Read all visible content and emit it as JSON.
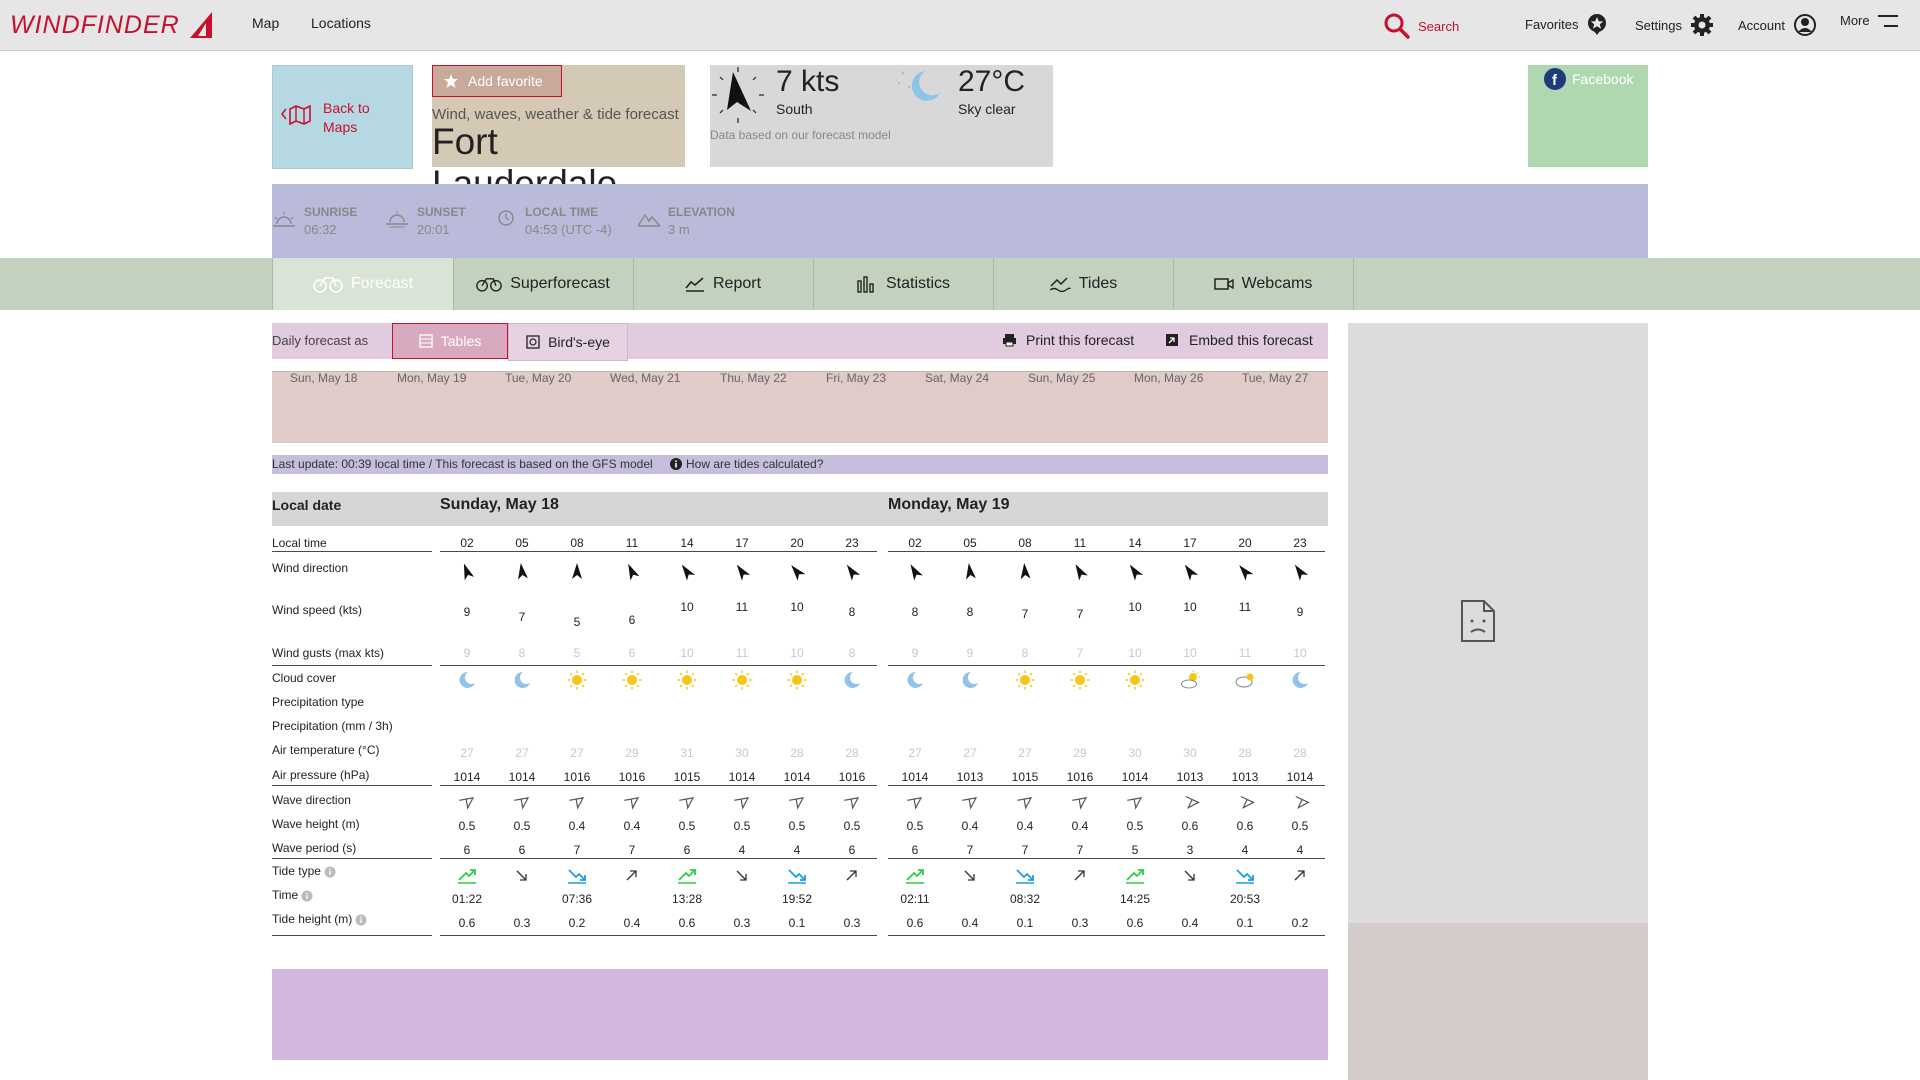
{
  "navbar": {
    "logo": "WINDFINDER",
    "links": [
      "Map",
      "Locations"
    ],
    "search_label": "Search",
    "favorites_label": "Favorites",
    "settings_label": "Settings",
    "account_label": "Account",
    "more_label": "More"
  },
  "back": {
    "label_line1": "Back to",
    "label_line2": "Maps"
  },
  "spot": {
    "add_favorite": "Add favorite",
    "subtitle": "Wind, waves, weather & tide forecast",
    "name": "Fort Lauderdale"
  },
  "current": {
    "wind_value": "7",
    "wind_unit": "kts",
    "wind_dir": "South",
    "temp_value": "27",
    "temp_unit": "°C",
    "sky": "Sky clear",
    "note": "Data based on our forecast model"
  },
  "social": {
    "facebook": "Facebook"
  },
  "info": [
    {
      "label": "SUNRISE",
      "value": "06:32"
    },
    {
      "label": "SUNSET",
      "value": "20:01"
    },
    {
      "label": "LOCAL TIME",
      "value": "04:53 (UTC -4)"
    },
    {
      "label": "ELEVATION",
      "value": "3 m"
    }
  ],
  "tabs": [
    "Forecast",
    "Superforecast",
    "Report",
    "Statistics",
    "Tides",
    "Webcams"
  ],
  "toolbar": {
    "daily_label": "Daily forecast as",
    "tables": "Tables",
    "birdseye": "Bird's-eye",
    "print": "Print this forecast",
    "embed": "Embed this forecast"
  },
  "days": [
    "Sun, May 18",
    "Mon, May 19",
    "Tue, May 20",
    "Wed, May 21",
    "Thu, May 22",
    "Fri, May 23",
    "Sat, May 24",
    "Sun, May 25",
    "Mon, May 26",
    "Tue, May 27"
  ],
  "update": {
    "text": "Last update: 00:39 local time / This forecast is based on the GFS model",
    "tides_link": "How are tides calculated?"
  },
  "table": {
    "local_date": "Local date",
    "day1": "Sunday, May 18",
    "day2": "Monday, May 19",
    "row_labels": [
      "Local time",
      "Wind direction",
      "Wind speed (kts)",
      "Wind gusts (max kts)",
      "Cloud cover",
      "Precipitation type",
      "Precipitation (mm / 3h)",
      "Air temperature (°C)",
      "Air pressure (hPa)",
      "Wave direction",
      "Wave height (m)",
      "Wave period (s)",
      "Tide type",
      "Time",
      "Tide height (m)"
    ],
    "times": [
      "02",
      "05",
      "08",
      "11",
      "14",
      "17",
      "20",
      "23",
      "02",
      "05",
      "08",
      "11",
      "14",
      "17",
      "20",
      "23"
    ],
    "wind_speed": [
      "9",
      "7",
      "5",
      "6",
      "10",
      "11",
      "10",
      "8",
      "8",
      "8",
      "7",
      "7",
      "10",
      "10",
      "11",
      "9"
    ],
    "wind_gusts": [
      "9",
      "8",
      "5",
      "6",
      "10",
      "11",
      "10",
      "8",
      "9",
      "9",
      "8",
      "7",
      "10",
      "10",
      "11",
      "10"
    ],
    "cloud": [
      "moon",
      "moon",
      "sun",
      "sun",
      "sun",
      "sun",
      "sun",
      "moon",
      "moon",
      "moon",
      "sun",
      "sun",
      "sun",
      "sun-cloud",
      "cloud-sun",
      "moon"
    ],
    "air_temp": [
      "27",
      "27",
      "27",
      "29",
      "31",
      "30",
      "28",
      "28",
      "27",
      "27",
      "27",
      "29",
      "30",
      "30",
      "28",
      "28"
    ],
    "pressure": [
      "1014",
      "1014",
      "1016",
      "1016",
      "1015",
      "1014",
      "1014",
      "1016",
      "1014",
      "1013",
      "1015",
      "1016",
      "1014",
      "1013",
      "1013",
      "1014"
    ],
    "wave_height": [
      "0.5",
      "0.5",
      "0.4",
      "0.4",
      "0.5",
      "0.5",
      "0.5",
      "0.5",
      "0.5",
      "0.4",
      "0.4",
      "0.4",
      "0.5",
      "0.6",
      "0.6",
      "0.5"
    ],
    "wave_period": [
      "6",
      "6",
      "7",
      "7",
      "6",
      "4",
      "4",
      "6",
      "6",
      "7",
      "7",
      "7",
      "5",
      "3",
      "4",
      "4"
    ],
    "tide_type": [
      "high",
      "falling",
      "low",
      "rising",
      "high",
      "falling",
      "low",
      "rising",
      "high",
      "falling",
      "low",
      "rising",
      "high",
      "falling",
      "low",
      "rising"
    ],
    "tide_time": [
      "01:22",
      "",
      "07:36",
      "",
      "13:28",
      "",
      "19:52",
      "",
      "02:11",
      "",
      "08:32",
      "",
      "14:25",
      "",
      "20:53",
      ""
    ],
    "tide_height": [
      "0.6",
      "0.3",
      "0.2",
      "0.4",
      "0.6",
      "0.3",
      "0.1",
      "0.3",
      "0.6",
      "0.4",
      "0.1",
      "0.3",
      "0.6",
      "0.4",
      "0.1",
      "0.2"
    ]
  },
  "colors": {
    "brand": "#c8102e",
    "sun": "#f5c518",
    "moon": "#8fc3e8",
    "tide_green": "#2ecc40",
    "tide_blue": "#1aa0e0"
  }
}
